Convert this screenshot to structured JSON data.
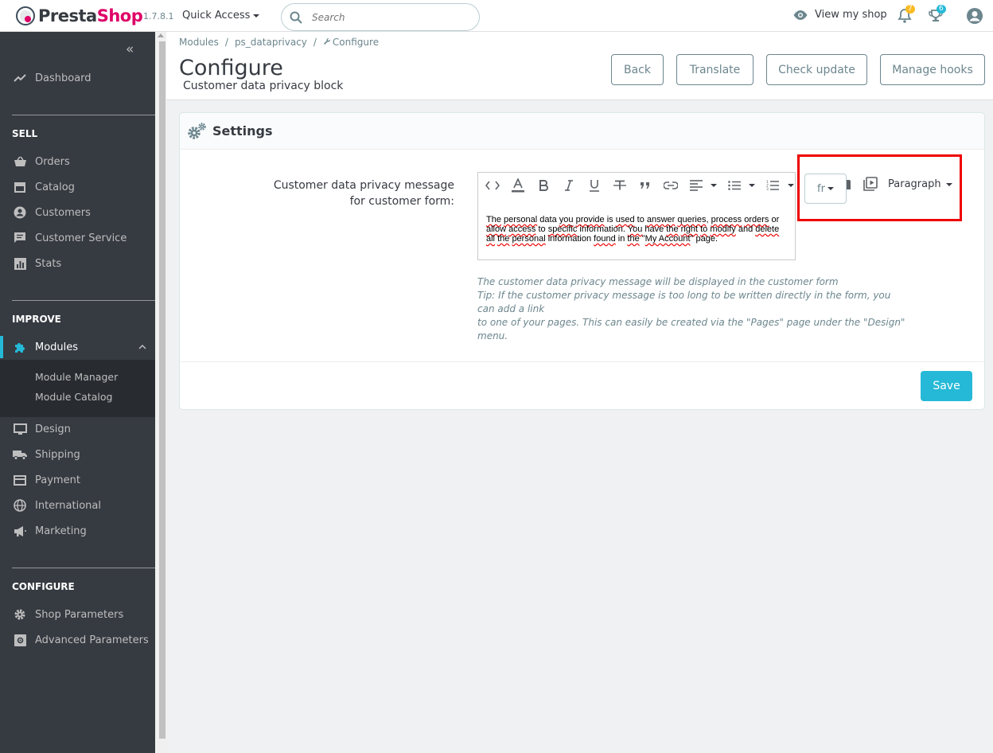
{
  "header": {
    "brand_prefix": "Presta",
    "brand_suffix": "Shop",
    "version": "1.7.8.1",
    "quick_access": "Quick Access",
    "search_placeholder": "Search",
    "view_shop": "View my shop",
    "orders_badge": "7",
    "customers_badge": "6"
  },
  "sidebar": {
    "dashboard": "Dashboard",
    "sell_title": "SELL",
    "sell_items": [
      "Orders",
      "Catalog",
      "Customers",
      "Customer Service",
      "Stats"
    ],
    "improve_title": "IMPROVE",
    "modules": "Modules",
    "module_sub": [
      "Module Manager",
      "Module Catalog"
    ],
    "improve_items": [
      "Design",
      "Shipping",
      "Payment",
      "International",
      "Marketing"
    ],
    "configure_title": "CONFIGURE",
    "configure_items": [
      "Shop Parameters",
      "Advanced Parameters"
    ]
  },
  "page": {
    "breadcrumb": [
      "Modules",
      "ps_dataprivacy",
      "Configure"
    ],
    "title": "Configure",
    "subtitle": "Customer data privacy block",
    "buttons": [
      "Back",
      "Translate",
      "Check update",
      "Manage hooks"
    ]
  },
  "panel": {
    "heading": "Settings",
    "field_label": "Customer data privacy message for customer form:",
    "editor_text_parts": [
      "The",
      " ",
      "personal",
      " data ",
      "you",
      " ",
      "provide",
      " is ",
      "used",
      " to ",
      "answer",
      " ",
      "queries",
      ", ",
      "process",
      " ",
      "orders",
      " or ",
      "allow",
      " ",
      "access",
      " to ",
      "specific",
      " information. ",
      "You",
      " have ",
      "the",
      " ",
      "right",
      " ",
      "to",
      " ",
      "modify",
      " and ",
      "delete",
      " ",
      "all",
      " ",
      "the",
      " ",
      "personal",
      " information ",
      "found",
      " in ",
      "the",
      " \"",
      "My Account",
      "\" page."
    ],
    "language": "fr",
    "format": "Paragraph",
    "help_lines": [
      "The customer data privacy message will be displayed in the customer form",
      "Tip: If the customer privacy message is too long to be written directly in the form, you can add a link",
      "to one of your pages. This can easily be created via the \"Pages\" page under the \"Design\" menu."
    ],
    "save": "Save"
  },
  "colors": {
    "accent": "#25b9d7",
    "brand_pink": "#df0067",
    "sidebar_bg": "#363a41",
    "highlight": "#e00000"
  }
}
